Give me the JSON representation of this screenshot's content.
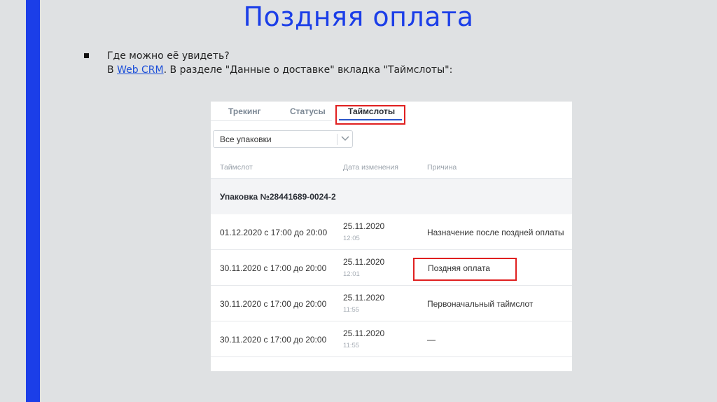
{
  "slide": {
    "title": "Поздняя оплата",
    "bullet_question": "Где можно её увидеть?",
    "bullet_prefix": "В ",
    "bullet_link": "Web CRM",
    "bullet_suffix": ". В разделе \"Данные о доставке\" вкладка \"Таймслоты\":"
  },
  "panel": {
    "tabs": [
      {
        "label": "Трекинг",
        "active": false
      },
      {
        "label": "Статусы",
        "active": false
      },
      {
        "label": "Таймслоты",
        "active": true
      }
    ],
    "filter": {
      "selected": "Все упаковки",
      "icon": "chevron-down-icon"
    },
    "columns": [
      "Таймслот",
      "Дата изменения",
      "Причина"
    ],
    "group_label": "Упаковка №28441689-0024-2",
    "rows": [
      {
        "slot": "01.12.2020 с 17:00 до 20:00",
        "date": "25.11.2020",
        "time": "12:05",
        "reason": "Назначение после поздней оплаты"
      },
      {
        "slot": "30.11.2020 с 17:00 до 20:00",
        "date": "25.11.2020",
        "time": "12:01",
        "reason": "Поздняя оплата"
      },
      {
        "slot": "30.11.2020 с 17:00 до 20:00",
        "date": "25.11.2020",
        "time": "11:55",
        "reason": "Первоначальный таймслот"
      },
      {
        "slot": "30.11.2020 с 17:00 до 20:00",
        "date": "25.11.2020",
        "time": "11:55",
        "reason": "—"
      }
    ]
  },
  "colors": {
    "accent": "#1b3ee8",
    "highlight": "#e02020",
    "tab_active": "#2a55c8"
  }
}
